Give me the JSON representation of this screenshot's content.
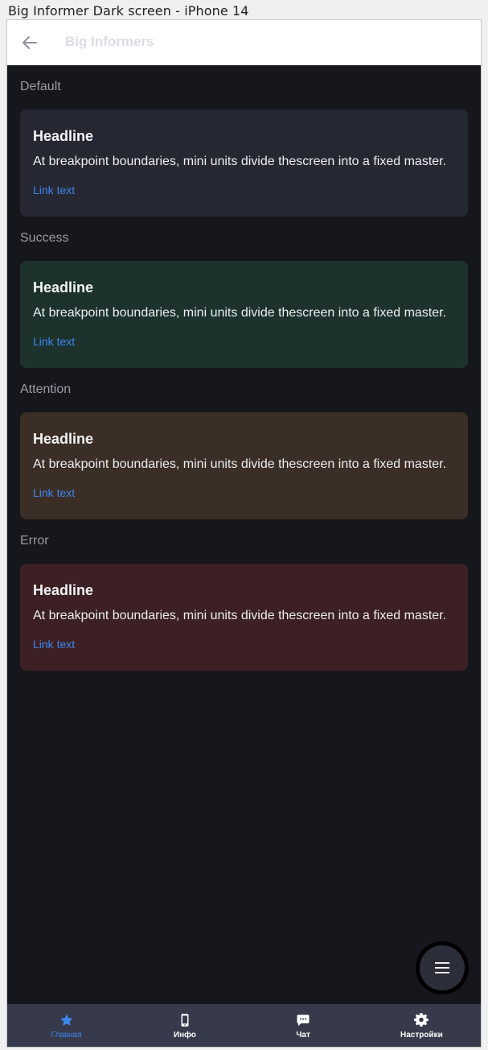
{
  "frame_title": "Big Informer Dark screen - iPhone 14",
  "topbar": {
    "title": "Big Informers",
    "back_icon": "arrow-left-icon"
  },
  "sections": [
    {
      "label": "Default",
      "headline": "Headline",
      "body": "At breakpoint boundaries, mini units divide thescreen into a fixed master.",
      "link": "Link text",
      "background": "#252833"
    },
    {
      "label": "Success",
      "headline": "Headline",
      "body": "At breakpoint boundaries, mini units divide thescreen into a fixed master.",
      "link": "Link text",
      "background": "#1d322d"
    },
    {
      "label": "Attention",
      "headline": "Headline",
      "body": "At breakpoint boundaries, mini units divide thescreen into a fixed master.",
      "link": "Link text",
      "background": "#3b2e26"
    },
    {
      "label": "Error",
      "headline": "Headline",
      "body": "At breakpoint boundaries, mini units divide thescreen into a fixed master.",
      "link": "Link text",
      "background": "#3c2023"
    }
  ],
  "fab": {
    "icon": "menu-icon"
  },
  "bottom_nav": {
    "items": [
      {
        "label": "Главная",
        "icon": "star-icon",
        "active": true
      },
      {
        "label": "Инфо",
        "icon": "phone-icon",
        "active": false
      },
      {
        "label": "Чат",
        "icon": "chat-icon",
        "active": false
      },
      {
        "label": "Настройки",
        "icon": "gear-icon",
        "active": false
      }
    ]
  },
  "colors": {
    "accent": "#3f86ee",
    "screen_background": "#16171c",
    "nav_background": "#363a4a"
  }
}
